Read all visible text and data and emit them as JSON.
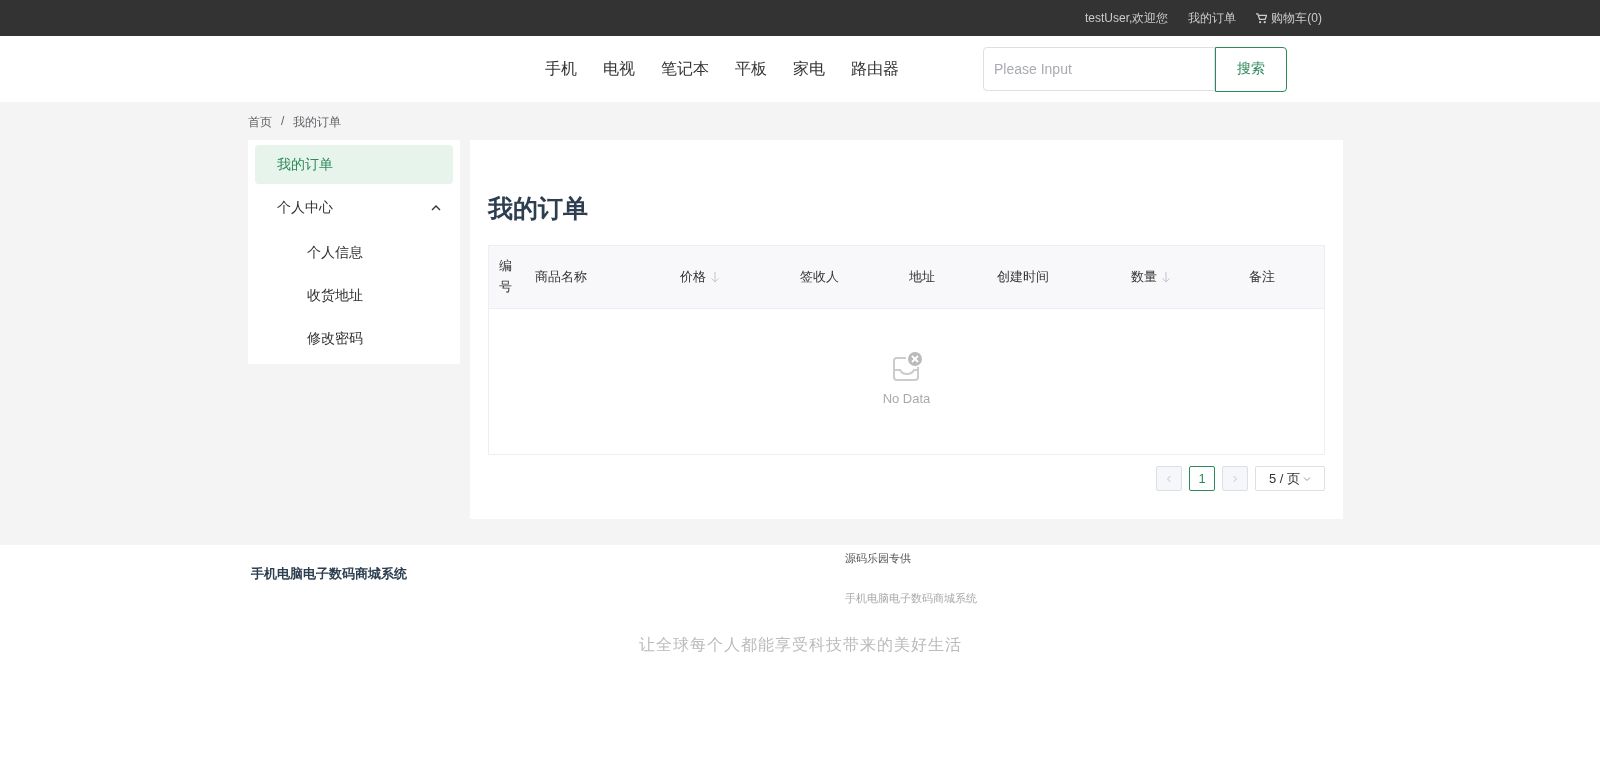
{
  "top_bar": {
    "welcome": "testUser,欢迎您",
    "links": [
      {
        "label": "我的订单",
        "kind": "text"
      },
      {
        "label": "购物车(0)",
        "kind": "cart"
      }
    ]
  },
  "header": {
    "nav": [
      "手机",
      "电视",
      "笔记本",
      "平板",
      "家电",
      "路由器"
    ],
    "search": {
      "placeholder": "Please Input",
      "button": "搜索"
    }
  },
  "breadcrumb": {
    "items": [
      "首页",
      "我的订单"
    ],
    "separator": "/"
  },
  "sidebar": {
    "items": [
      {
        "label": "我的订单",
        "selected": true
      },
      {
        "label": "个人中心",
        "selected": false,
        "expanded": true,
        "children": [
          {
            "label": "个人信息",
            "selected": false
          },
          {
            "label": "收货地址",
            "selected": false
          },
          {
            "label": "修改密码",
            "selected": false
          }
        ]
      }
    ]
  },
  "main": {
    "title": "我的订单",
    "table": {
      "columns": [
        {
          "label": "编号",
          "sortable": false
        },
        {
          "label": "商品名称",
          "sortable": false
        },
        {
          "label": "价格",
          "sortable": true
        },
        {
          "label": "签收人",
          "sortable": false
        },
        {
          "label": "地址",
          "sortable": false
        },
        {
          "label": "创建时间",
          "sortable": false
        },
        {
          "label": "数量",
          "sortable": true
        },
        {
          "label": "备注",
          "sortable": false
        }
      ],
      "empty_text": "No Data"
    },
    "pagination": {
      "pages": [
        {
          "label": "1",
          "selected": true
        }
      ],
      "prev_disabled": true,
      "next_disabled": true,
      "page_size": "5 / 页"
    }
  },
  "footer": {
    "title": "手机电脑电子数码商城系统",
    "credit": "源码乐园专供",
    "subtitle": "手机电脑电子数码商城系统",
    "slogan": "让全球每个人都能享受科技带来的美好生活"
  }
}
